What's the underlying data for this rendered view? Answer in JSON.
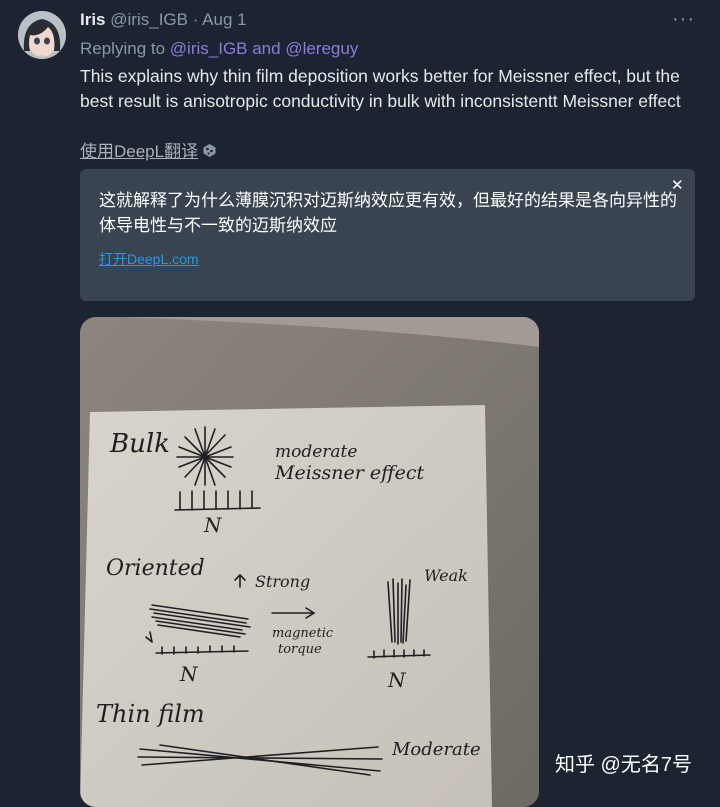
{
  "tweet": {
    "author_name": "Iris",
    "handle_date": "@iris_IGB · Aug 1",
    "replying_prefix": "Replying to",
    "replying_users": "@iris_IGB and @lereguy",
    "more_icon": "···",
    "text": "This explains why thin film deposition works better for Meissner effect, but the best result is anisotropic conductivity in bulk with inconsistentt Meissner effect",
    "translate_label": "使用DeepL翻译"
  },
  "translation": {
    "text": "这就解释了为什么薄膜沉积对迈斯纳效应更有效，但最好的结果是各向异性的体导电性与不一致的迈斯纳效应",
    "open_link": "打开DeepL.com",
    "close_icon": "✕"
  },
  "photo": {
    "labels": {
      "bulk": "Bulk",
      "moderate_1": "moderate",
      "meissner": "Meissner effect",
      "n1": "N",
      "oriented": "Oriented",
      "strong": "Strong",
      "magnetic": "magnetic",
      "torque": "torque",
      "weak": "Weak",
      "n2": "N",
      "n3": "N",
      "thin_film": "Thin film",
      "moderate_2": "Moderate"
    }
  },
  "watermark": "知乎 @无名7号"
}
